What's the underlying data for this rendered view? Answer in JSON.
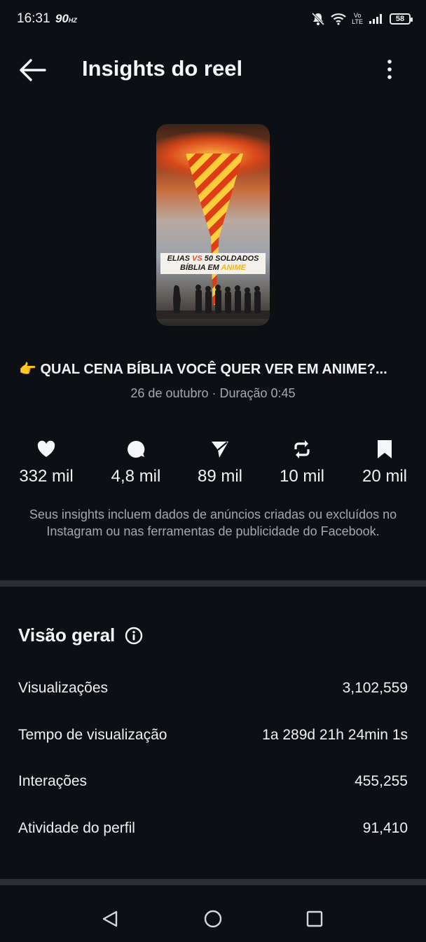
{
  "status": {
    "time": "16:31",
    "refresh": "90",
    "refresh_unit": "HZ",
    "volte_top": "Vo",
    "volte_bottom": "LTE",
    "battery": "58"
  },
  "header": {
    "title": "Insights do reel"
  },
  "reel": {
    "thumbnail_caption_line1_a": "ELIAS ",
    "thumbnail_caption_line1_vs": "VS",
    "thumbnail_caption_line1_b": " 50 SOLDADOS",
    "thumbnail_caption_line2_a": "BÍBLIA EM ",
    "thumbnail_caption_line2_b": "ANIME",
    "caption": "👉 QUAL CENA BÍBLIA VOCÊ QUER VER EM ANIME?...",
    "meta": "26 de outubro · Duração 0:45"
  },
  "stats": [
    {
      "icon": "heart-icon",
      "value": "332 mil"
    },
    {
      "icon": "comment-icon",
      "value": "4,8 mil"
    },
    {
      "icon": "send-icon",
      "value": "89 mil"
    },
    {
      "icon": "repost-icon",
      "value": "10 mil"
    },
    {
      "icon": "bookmark-icon",
      "value": "20 mil"
    }
  ],
  "note": "Seus insights incluem dados de anúncios criadas ou excluídos no Instagram ou nas ferramentas de publicidade do Facebook.",
  "overview": {
    "title": "Visão geral",
    "rows": [
      {
        "label": "Visualizações",
        "value": "3,102,559"
      },
      {
        "label": "Tempo de visualização",
        "value": "1a 289d 21h 24min 1s"
      },
      {
        "label": "Interações",
        "value": "455,255"
      },
      {
        "label": "Atividade do perfil",
        "value": "91,410"
      }
    ]
  },
  "colors": {
    "background": "#0c0f14",
    "divider": "#2a2d33",
    "muted_text": "#a4a8b0"
  }
}
